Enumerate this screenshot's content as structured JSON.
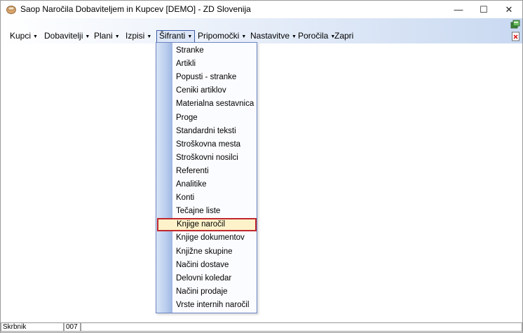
{
  "window": {
    "title": "Saop Naročila Dobaviteljem in Kupcev [DEMO] - ZD Slovenija",
    "minimize_glyph": "—",
    "maximize_glyph": "☐",
    "close_glyph": "✕"
  },
  "menubar": {
    "items": [
      {
        "label": "Kupci",
        "has_caret": true
      },
      {
        "label": "Dobavitelji",
        "has_caret": true
      },
      {
        "label": "Plani",
        "has_caret": true
      },
      {
        "label": "Izpisi",
        "has_caret": true
      },
      {
        "label": "Šifranti",
        "has_caret": true,
        "active": true
      },
      {
        "label": "Pripomočki",
        "has_caret": true
      },
      {
        "label": "Nastavitve",
        "has_caret": true
      },
      {
        "label": "Poročila",
        "has_caret": true
      },
      {
        "label": "Zapri",
        "has_caret": false
      }
    ],
    "caret_glyph": "▼"
  },
  "right_icons": [
    "window-restore-icon",
    "close-document-icon"
  ],
  "dropdown": {
    "items": [
      "Stranke",
      "Artikli",
      "Popusti - stranke",
      "Ceniki artiklov",
      "Materialna sestavnica",
      "Proge",
      "Standardni teksti",
      "Stroškovna mesta",
      "Stroškovni nosilci",
      "Referenti",
      "Analitike",
      "Konti",
      "Tečajne liste",
      "Knjige naročil",
      "Knjige dokumentov",
      "Knjižne skupine",
      "Načini dostave",
      "Delovni koledar",
      "Načini prodaje",
      "Vrste internih naročil"
    ],
    "highlighted": "Knjige naročil"
  },
  "statusbar": {
    "user": "Skrbnik",
    "code": "007",
    "message": ""
  },
  "colors": {
    "menu_gradient_end": "#c9d9f1",
    "dropdown_border": "#6c84c2",
    "highlight_border": "#c1272d",
    "highlight_fill": "#fdf2c9"
  }
}
